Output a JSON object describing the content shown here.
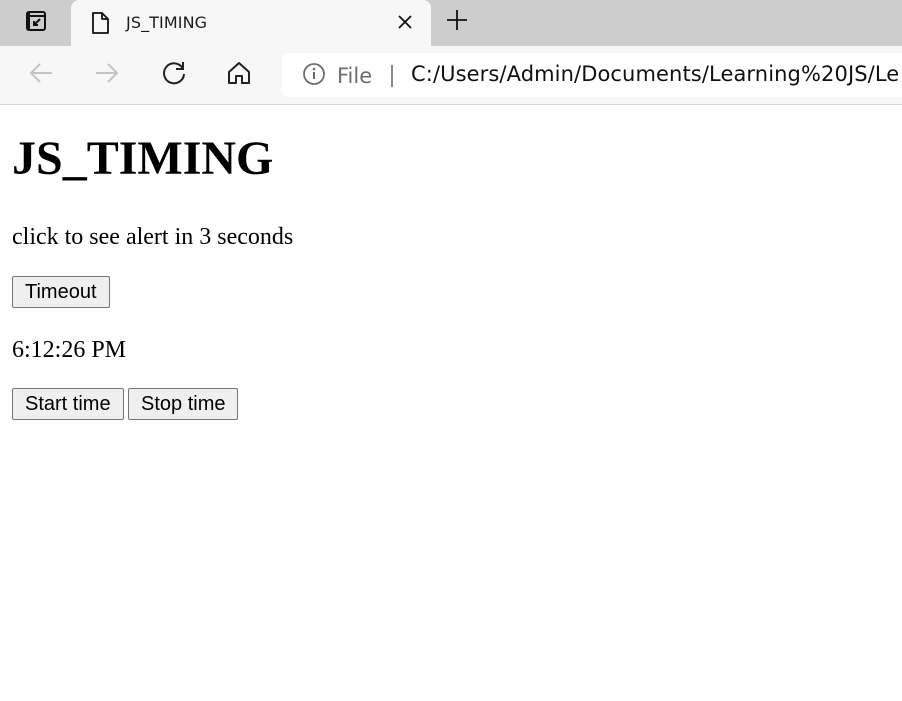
{
  "browser": {
    "tab": {
      "title": "JS_TIMING"
    },
    "address_bar": {
      "site_info_label": "File",
      "url": "C:/Users/Admin/Documents/Learning%20JS/Le"
    }
  },
  "page": {
    "heading": "JS_TIMING",
    "description": "click to see alert in 3 seconds",
    "timeout_button_label": "Timeout",
    "clock_text": "6:12:26 PM",
    "start_button_label": "Start time",
    "stop_button_label": "Stop time"
  },
  "icons": {
    "tab_actions": "tab-actions-icon",
    "favicon": "document-icon",
    "close": "close-icon",
    "new_tab": "plus-icon",
    "back": "back-arrow-icon",
    "forward": "forward-arrow-icon",
    "refresh": "refresh-icon",
    "home": "home-icon",
    "info": "info-icon"
  }
}
